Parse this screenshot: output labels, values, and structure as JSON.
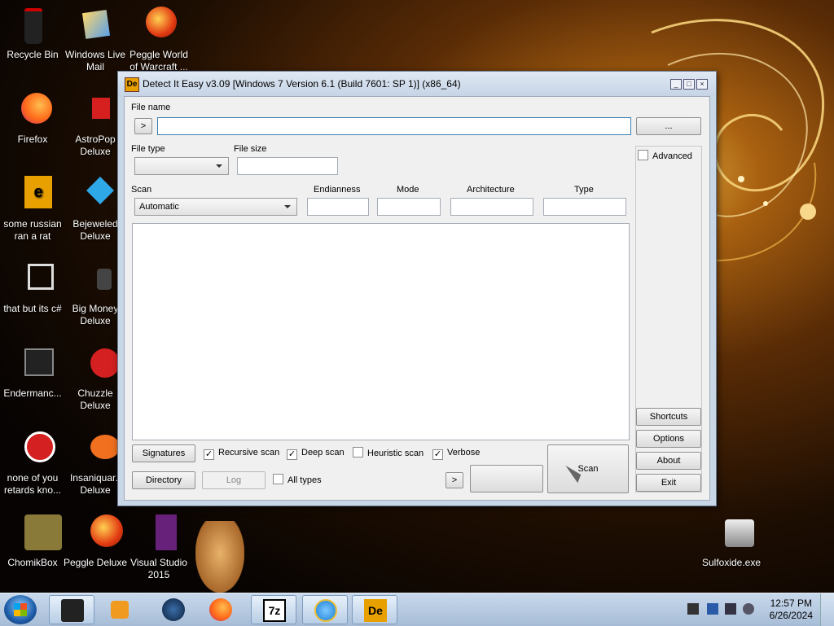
{
  "desktop": {
    "icons": [
      {
        "label": "Recycle Bin"
      },
      {
        "label": "Windows Live Mail"
      },
      {
        "label": "Peggle World of Warcraft ..."
      },
      {
        "label": "Firefox"
      },
      {
        "label": "AstroPop Deluxe"
      },
      {
        "label": "some russian ran a rat"
      },
      {
        "label": "Bejeweled Deluxe"
      },
      {
        "label": "that but its c#"
      },
      {
        "label": "Big Money Deluxe"
      },
      {
        "label": "Endermanc..."
      },
      {
        "label": "Chuzzle Deluxe"
      },
      {
        "label": "none of you retards kno..."
      },
      {
        "label": "Insaniquar.. Deluxe"
      },
      {
        "label": "ChomikBox"
      },
      {
        "label": "Peggle Deluxe"
      },
      {
        "label": "Visual Studio 2015"
      },
      {
        "label": "Sulfoxide.exe"
      }
    ]
  },
  "window": {
    "app_icon_text": "De",
    "title": "Detect It Easy v3.09 [Windows 7 Version 6.1 (Build 7601: SP 1)] (x86_64)",
    "file_name_label": "File name",
    "file_name_value": "",
    "history_button": ">",
    "browse_button": "...",
    "file_type_label": "File type",
    "file_type_value": "",
    "file_size_label": "File size",
    "file_size_value": "",
    "scan_label": "Scan",
    "scan_value": "Automatic",
    "endianness_label": "Endianness",
    "mode_label": "Mode",
    "architecture_label": "Architecture",
    "type_label": "Type",
    "advanced_label": "Advanced",
    "signatures_button": "Signatures",
    "recursive_scan": {
      "label": "Recursive scan",
      "checked": true
    },
    "deep_scan": {
      "label": "Deep scan",
      "checked": true
    },
    "heuristic_scan": {
      "label": "Heuristic scan",
      "checked": false
    },
    "verbose": {
      "label": "Verbose",
      "checked": true
    },
    "all_types": {
      "label": "All types",
      "checked": false
    },
    "directory_button": "Directory",
    "log_button": "Log",
    "next_button": ">",
    "scan_button": "Scan",
    "shortcuts_button": "Shortcuts",
    "options_button": "Options",
    "about_button": "About",
    "exit_button": "Exit",
    "check_mark": "✓"
  },
  "taskbar": {
    "pinned": [
      "windows-explorer",
      "media-player",
      "steam",
      "firefox",
      "7zip",
      "internet-explorer",
      "detect-it-easy"
    ],
    "time": "12:57 PM",
    "date": "6/26/2024"
  },
  "colors": {
    "accent": "#3c7fb1",
    "window_frame": "#c9d6e6"
  }
}
